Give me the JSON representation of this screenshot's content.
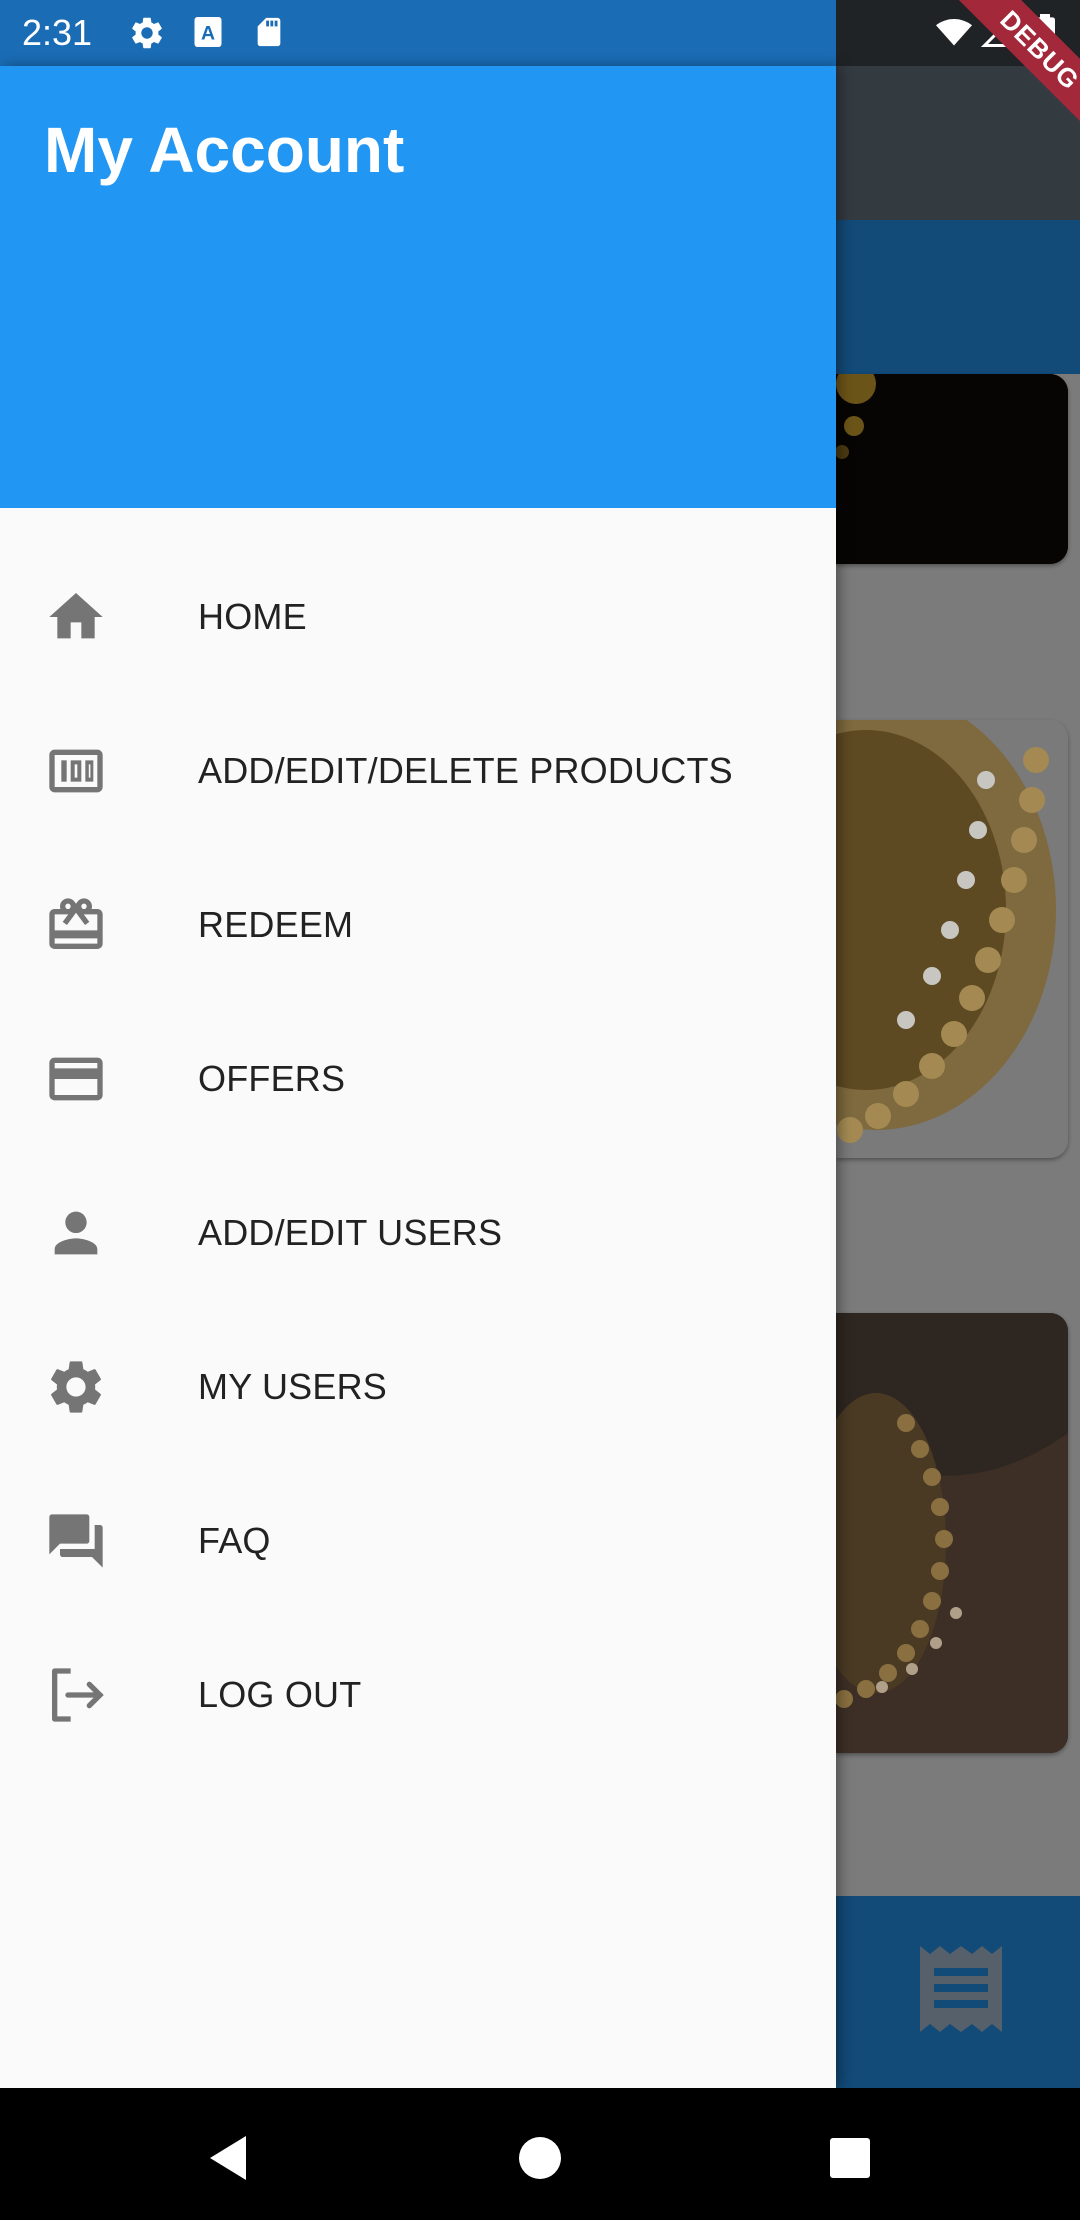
{
  "status_bar": {
    "time": "2:31",
    "icons": [
      "settings-icon",
      "text-a-icon",
      "sd-card-icon",
      "wifi-icon",
      "signal-icon",
      "battery-icon"
    ],
    "debug_label": "DEBUG"
  },
  "drawer": {
    "title": "My Account",
    "items": [
      {
        "label": "HOME",
        "icon": "home-icon"
      },
      {
        "label": "ADD/EDIT/DELETE PRODUCTS",
        "icon": "counter-100-icon"
      },
      {
        "label": "REDEEM",
        "icon": "redeem-gift-card-icon"
      },
      {
        "label": "OFFERS",
        "icon": "credit-card-icon"
      },
      {
        "label": "ADD/EDIT USERS",
        "icon": "person-icon"
      },
      {
        "label": "MY USERS",
        "icon": "gear-icon"
      },
      {
        "label": "FAQ",
        "icon": "forum-icon"
      },
      {
        "label": "LOG OUT",
        "icon": "logout-icon"
      }
    ]
  },
  "background": {
    "bottom_bar_icon": "receipt-icon"
  },
  "nav_bar": {
    "buttons": [
      "back-icon",
      "home-circle-icon",
      "recents-square-icon"
    ]
  },
  "colors": {
    "drawer_header": "#2196f3",
    "status_bar": "#1a6cb5",
    "menu_icon": "#757575",
    "menu_text": "#222222",
    "app_bar_dim": "#124a78",
    "debug_banner": "#a3283a"
  }
}
